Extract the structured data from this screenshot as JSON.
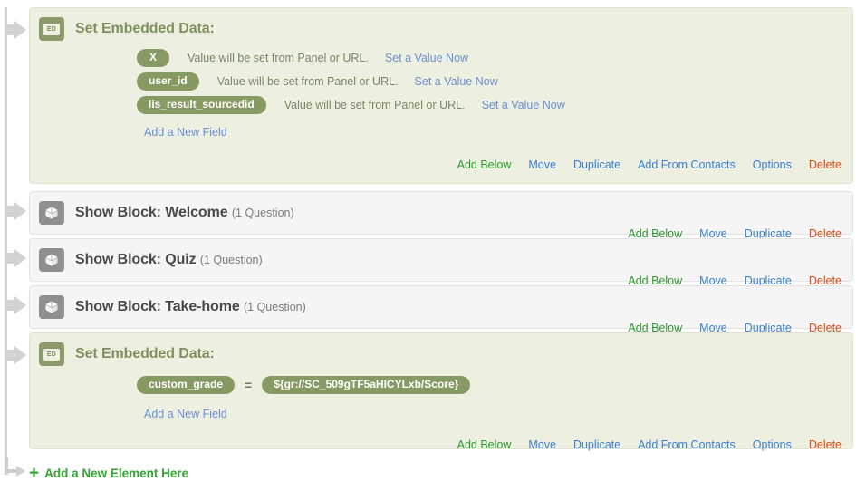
{
  "flow": {
    "elements": [
      {
        "kind": "embedded_data",
        "icon": "embedded-data-icon",
        "icon_label": "ED",
        "title": "Set Embedded Data:",
        "fields": [
          {
            "name": "X",
            "note": "Value will be set from Panel or URL.",
            "link": "Set a Value Now"
          },
          {
            "name": "user_id",
            "note": "Value will be set from Panel or URL.",
            "link": "Set a Value Now"
          },
          {
            "name": "lis_result_sourcedid",
            "note": "Value will be set from Panel or URL.",
            "link": "Set a Value Now"
          }
        ],
        "add_field_label": "Add a New Field",
        "actions": [
          {
            "label": "Add Below",
            "style": "add"
          },
          {
            "label": "Move",
            "style": "blue"
          },
          {
            "label": "Duplicate",
            "style": "blue"
          },
          {
            "label": "Add From Contacts",
            "style": "blue"
          },
          {
            "label": "Options",
            "style": "blue"
          },
          {
            "label": "Delete",
            "style": "delete"
          }
        ]
      },
      {
        "kind": "block",
        "icon": "block-cube-icon",
        "title": "Show Block: Welcome",
        "question_count": "(1 Question)",
        "actions": [
          {
            "label": "Add Below",
            "style": "add"
          },
          {
            "label": "Move",
            "style": "blue"
          },
          {
            "label": "Duplicate",
            "style": "blue"
          },
          {
            "label": "Delete",
            "style": "delete"
          }
        ]
      },
      {
        "kind": "block",
        "icon": "block-cube-icon",
        "title": "Show Block: Quiz",
        "question_count": "(1 Question)",
        "actions": [
          {
            "label": "Add Below",
            "style": "add"
          },
          {
            "label": "Move",
            "style": "blue"
          },
          {
            "label": "Duplicate",
            "style": "blue"
          },
          {
            "label": "Delete",
            "style": "delete"
          }
        ]
      },
      {
        "kind": "block",
        "icon": "block-cube-icon",
        "title": "Show Block: Take-home",
        "question_count": "(1 Question)",
        "actions": [
          {
            "label": "Add Below",
            "style": "add"
          },
          {
            "label": "Move",
            "style": "blue"
          },
          {
            "label": "Duplicate",
            "style": "blue"
          },
          {
            "label": "Delete",
            "style": "delete"
          }
        ]
      },
      {
        "kind": "embedded_data",
        "icon": "embedded-data-icon",
        "icon_label": "ED",
        "title": "Set Embedded Data:",
        "fields": [
          {
            "name": "custom_grade",
            "equals": "=",
            "value": "${gr://SC_509gTF5aHICYLxb/Score}"
          }
        ],
        "add_field_label": "Add a New Field",
        "actions": [
          {
            "label": "Add Below",
            "style": "add"
          },
          {
            "label": "Move",
            "style": "blue"
          },
          {
            "label": "Duplicate",
            "style": "blue"
          },
          {
            "label": "Add From Contacts",
            "style": "blue"
          },
          {
            "label": "Options",
            "style": "blue"
          },
          {
            "label": "Delete",
            "style": "delete"
          }
        ]
      }
    ],
    "add_element": {
      "plus": "+",
      "label": "Add a New Element Here"
    }
  },
  "colors": {
    "embedded_card_bg": "#edf0e1",
    "embedded_card_border": "#dfe3cf",
    "block_card_bg": "#f5f5f5",
    "block_card_border": "#e3e3e3",
    "pill_green": "#879a63",
    "title_green": "#7f9060",
    "title_gray": "#4a4a4a",
    "link_blue_soft": "#6d8fd0",
    "action_green": "#2e9c2e",
    "action_blue": "#3a7fd5",
    "action_red": "#e04b18",
    "rail_gray": "#d2d2d2"
  }
}
